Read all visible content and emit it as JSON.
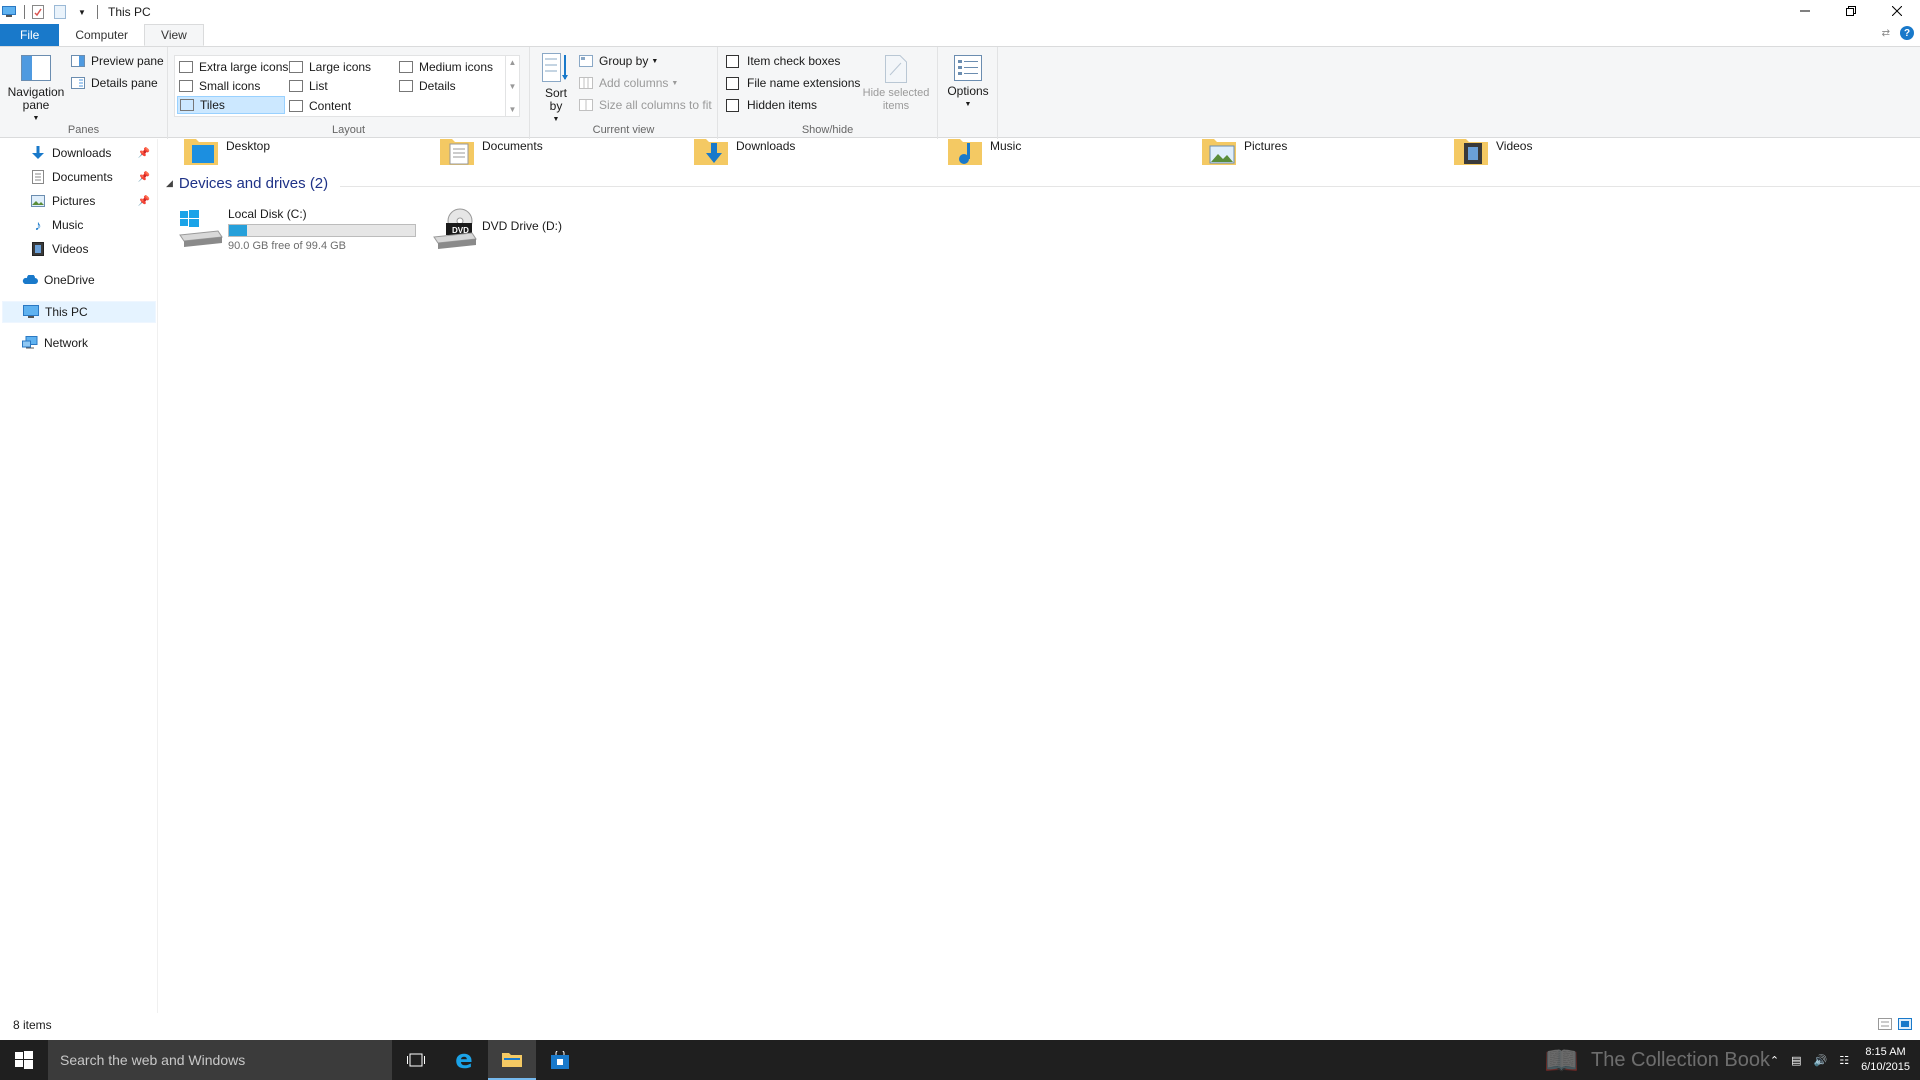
{
  "window": {
    "title": "This PC",
    "qat": [
      "computer-icon",
      "properties-icon",
      "new-folder-icon",
      "customize-dropdown-icon"
    ],
    "controls": [
      "minimize",
      "restore",
      "close"
    ]
  },
  "ribbon_tabs": {
    "file": "File",
    "computer": "Computer",
    "view": "View"
  },
  "ribbon": {
    "panes": {
      "label": "Panes",
      "navigation_pane": "Navigation pane",
      "preview_pane": "Preview pane",
      "details_pane": "Details pane"
    },
    "layout": {
      "label": "Layout",
      "items": {
        "extra_large": "Extra large icons",
        "large": "Large icons",
        "medium": "Medium icons",
        "small": "Small icons",
        "list": "List",
        "details": "Details",
        "tiles": "Tiles",
        "content": "Content"
      },
      "selected": "Tiles"
    },
    "current_view": {
      "label": "Current view",
      "sort_by": "Sort by",
      "group_by": "Group by",
      "add_columns": "Add columns",
      "size_columns": "Size all columns to fit"
    },
    "show_hide": {
      "label": "Show/hide",
      "item_check_boxes": "Item check boxes",
      "file_name_extensions": "File name extensions",
      "hidden_items": "Hidden items",
      "hide_selected": "Hide selected items"
    },
    "options": "Options"
  },
  "nav": {
    "items": [
      {
        "label": "Downloads",
        "icon": "download-arrow-icon",
        "pinned": true
      },
      {
        "label": "Documents",
        "icon": "documents-icon",
        "pinned": true
      },
      {
        "label": "Pictures",
        "icon": "pictures-icon",
        "pinned": true
      },
      {
        "label": "Music",
        "icon": "music-note-icon",
        "pinned": false
      },
      {
        "label": "Videos",
        "icon": "videos-icon",
        "pinned": false
      },
      {
        "label": "OneDrive",
        "icon": "cloud-icon",
        "pinned": false
      },
      {
        "label": "This PC",
        "icon": "computer-icon",
        "pinned": false,
        "selected": true
      },
      {
        "label": "Network",
        "icon": "network-icon",
        "pinned": false
      }
    ]
  },
  "content": {
    "folders": [
      "Desktop",
      "Documents",
      "Downloads",
      "Music",
      "Pictures",
      "Videos"
    ],
    "devices_header": "Devices and drives (2)",
    "drives": [
      {
        "name": "Local Disk (C:)",
        "free": "90.0 GB free of 99.4 GB",
        "used_fraction": 0.095
      },
      {
        "name": "DVD Drive (D:)",
        "badge": "DVD"
      }
    ]
  },
  "status": {
    "count": "8 items"
  },
  "taskbar": {
    "search_placeholder": "Search the web and Windows",
    "watermark": "The Collection Book",
    "time": "8:15 AM",
    "date": "6/10/2015"
  },
  "colors": {
    "accent": "#1979ca",
    "progress": "#26a0da",
    "folder": "#f4c963",
    "taskbar": "#1f1f1f"
  }
}
